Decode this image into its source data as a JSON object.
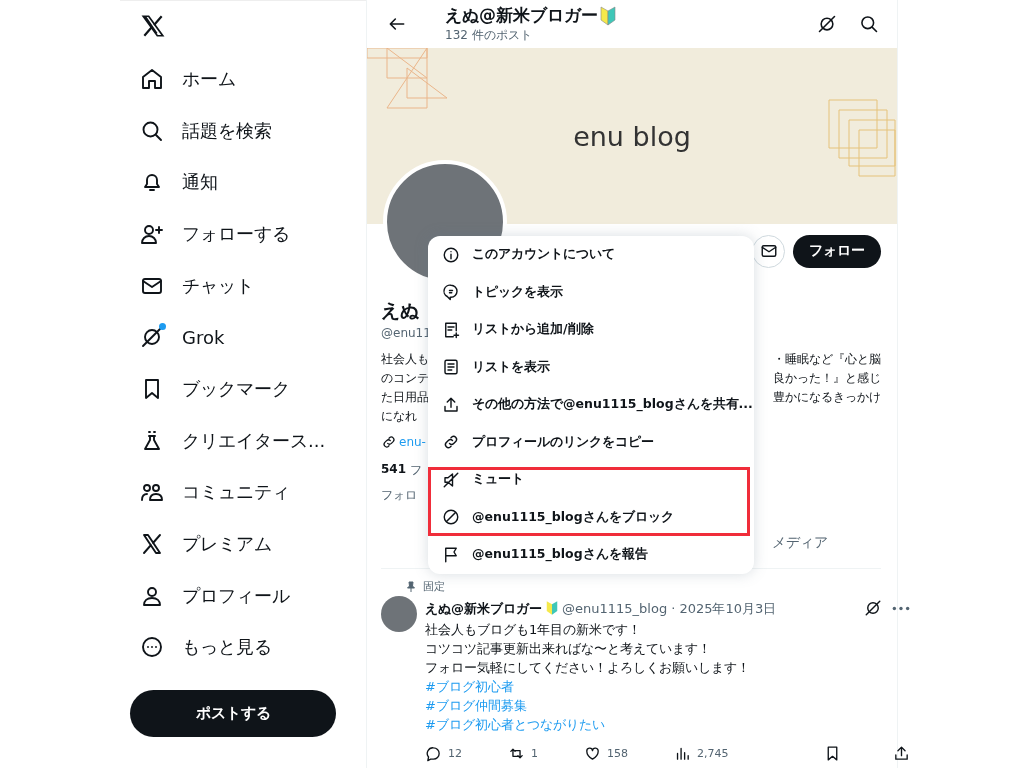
{
  "sidebar": {
    "items": [
      {
        "label": "ホーム",
        "badge": false
      },
      {
        "label": "話題を検索",
        "badge": false
      },
      {
        "label": "通知",
        "badge": false
      },
      {
        "label": "フォローする",
        "badge": false
      },
      {
        "label": "チャット",
        "badge": false
      },
      {
        "label": "Grok",
        "badge": true
      },
      {
        "label": "ブックマーク",
        "badge": false
      },
      {
        "label": "クリエイタース...",
        "badge": false
      },
      {
        "label": "コミュニティ",
        "badge": false
      },
      {
        "label": "プレミアム",
        "badge": false
      },
      {
        "label": "プロフィール",
        "badge": false
      },
      {
        "label": "もっと見る",
        "badge": false
      }
    ],
    "post_button": "ポストする"
  },
  "header": {
    "title": "えぬ@新米ブロガー",
    "post_count": "132 件のポスト"
  },
  "banner": {
    "text": "enu blog"
  },
  "profile": {
    "follow_button": "フォロー",
    "name_visible": "えぬ",
    "handle_visible": "@enu11",
    "bio_left": [
      "社会人も",
      "のコンテ",
      "た日用品",
      "になれ"
    ],
    "bio_right": [
      "・睡眠など『心と脳",
      "良かった！』と感じ",
      "豊かになるきっかけ"
    ],
    "link_visible": "enu-",
    "following_count": "541",
    "following_visible": "フ",
    "followers_visible": "フォロ"
  },
  "tabs": [
    {
      "label": "メディア",
      "selected": false
    }
  ],
  "menu": {
    "items": [
      {
        "label": "このアカウントについて",
        "highlighted": false
      },
      {
        "label": "トピックを表示",
        "highlighted": false
      },
      {
        "label": "リストから追加/削除",
        "highlighted": false
      },
      {
        "label": "リストを表示",
        "highlighted": false
      },
      {
        "label": "その他の方法で@enu1115_blogさんを共有...",
        "highlighted": false
      },
      {
        "label": "プロフィールのリンクをコピー",
        "highlighted": false
      },
      {
        "label": "ミュート",
        "highlighted": true
      },
      {
        "label": "@enu1115_blogさんをブロック",
        "highlighted": true
      },
      {
        "label": "@enu1115_blogさんを報告",
        "highlighted": false
      }
    ]
  },
  "post": {
    "pinned": "固定",
    "author": "えぬ@新米ブロガー",
    "handle": "@enu1115_blog",
    "date": "· 2025年10月3日",
    "lines": [
      "社会人もブログも1年目の新米です！",
      "コツコツ記事更新出来ればな〜と考えています！",
      "フォロー気軽にしてください！よろしくお願いします！"
    ],
    "hashtags": [
      "#ブログ初心者",
      "#ブログ仲間募集",
      "#ブログ初心者とつながりたい"
    ],
    "actions": [
      {
        "count": "12"
      },
      {
        "count": "1"
      },
      {
        "count": "158"
      },
      {
        "count": "2,745"
      }
    ]
  }
}
